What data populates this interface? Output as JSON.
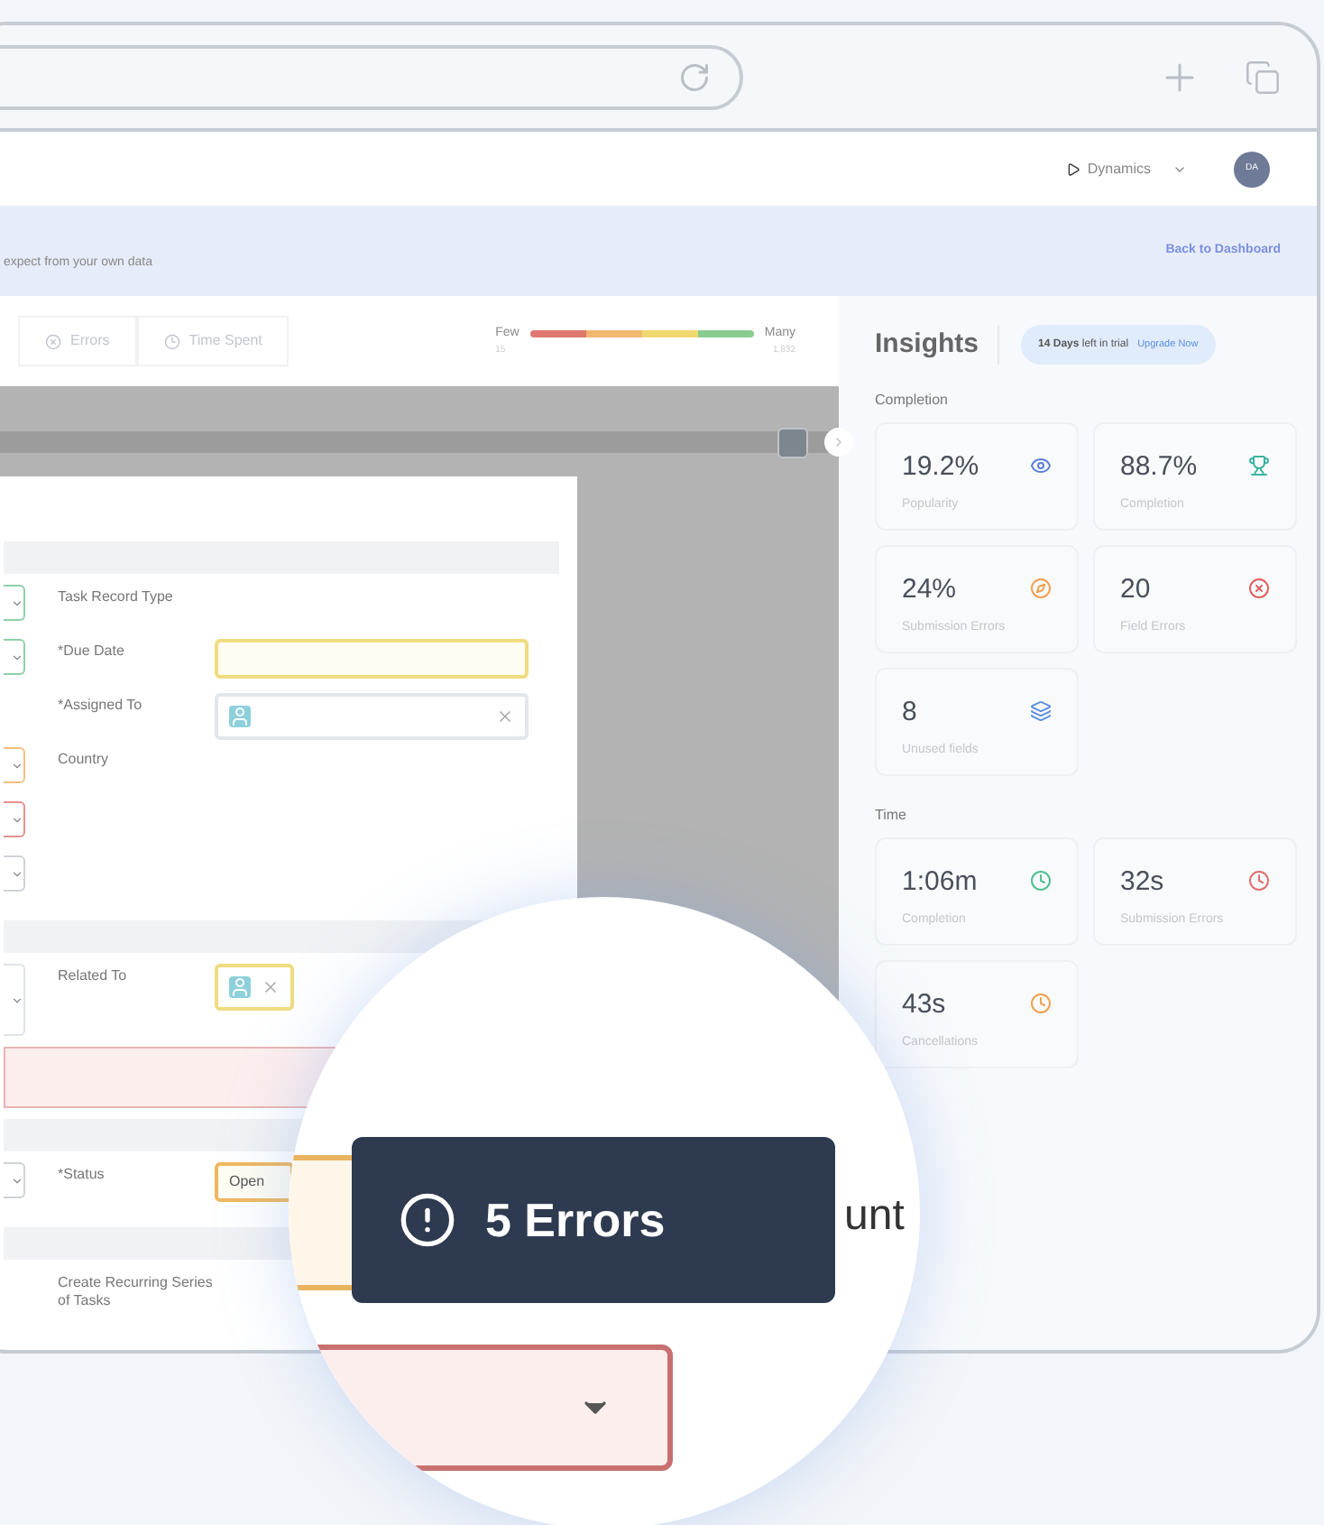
{
  "app_header": {
    "product": "Dynamics",
    "avatar": "DA"
  },
  "banner": {
    "text": "expect from your own data",
    "link": "Back to Dashboard"
  },
  "filters": [
    {
      "label": "Errors"
    },
    {
      "label": "Time Spent"
    }
  ],
  "legend": {
    "low_label": "Few",
    "low_value": "15",
    "high_label": "Many",
    "high_value": "1,832"
  },
  "form_rows": [
    {
      "kind": "section"
    },
    {
      "kind": "field",
      "label": "Task Record Type",
      "left_field": {
        "color": "#8fd0a8"
      }
    },
    {
      "kind": "field",
      "label": "*Due Date",
      "left_field": {
        "color": "#8fd0a8"
      },
      "input": {
        "kind": "text",
        "color": "#f0dc80"
      }
    },
    {
      "kind": "field",
      "label": "*Assigned To",
      "input": {
        "kind": "lookup",
        "color": "#e3e6ea"
      }
    },
    {
      "kind": "field",
      "label": "Country",
      "left_field": {
        "color": "#f0c080"
      }
    },
    {
      "kind": "field",
      "left_field": {
        "color": "#e89090"
      }
    },
    {
      "kind": "field",
      "left_field": {
        "color": "#cfd3d8"
      }
    },
    {
      "kind": "section"
    },
    {
      "kind": "field",
      "label": "Related To",
      "left_field": {
        "color": "#dfe3e8"
      },
      "input": {
        "kind": "lookup",
        "color": "#f0dc80"
      }
    },
    {
      "kind": "error_band"
    },
    {
      "kind": "section"
    },
    {
      "kind": "field",
      "label": "*Status",
      "left_field": {
        "color": "#cfd3d8"
      },
      "input": {
        "kind": "text",
        "color": "#f0b860",
        "value": "Open"
      }
    },
    {
      "kind": "section"
    },
    {
      "kind": "field",
      "label": "Create Recurring Series of Tasks"
    }
  ],
  "insights": {
    "title": "Insights",
    "trial": {
      "days": "14 Days",
      "text": "left in trial",
      "link": "Upgrade Now"
    },
    "sections": [
      {
        "title": "Completion",
        "cards": [
          {
            "value": "19.2%",
            "label": "Popularity",
            "color": "#5b7fd6"
          },
          {
            "value": "88.7%",
            "label": "Completion",
            "color": "#3bb5a0"
          },
          {
            "value": "24%",
            "label": "Submission Errors",
            "color": "#f0a050"
          },
          {
            "value": "20",
            "label": "Field Errors",
            "color": "#e06060"
          },
          {
            "value": "8",
            "label": "Unused fields",
            "color": "#5b8fe0"
          }
        ]
      },
      {
        "title": "Time",
        "cards": [
          {
            "value": "1:06m",
            "label": "Completion",
            "color": "#50c090"
          },
          {
            "value": "32s",
            "label": "Submission Errors",
            "color": "#e07070"
          },
          {
            "value": "43s",
            "label": "Cancellations",
            "color": "#f0a050"
          }
        ]
      }
    ]
  },
  "magnifier": {
    "tooltip": "5 Errors",
    "partial_text": "unt"
  }
}
